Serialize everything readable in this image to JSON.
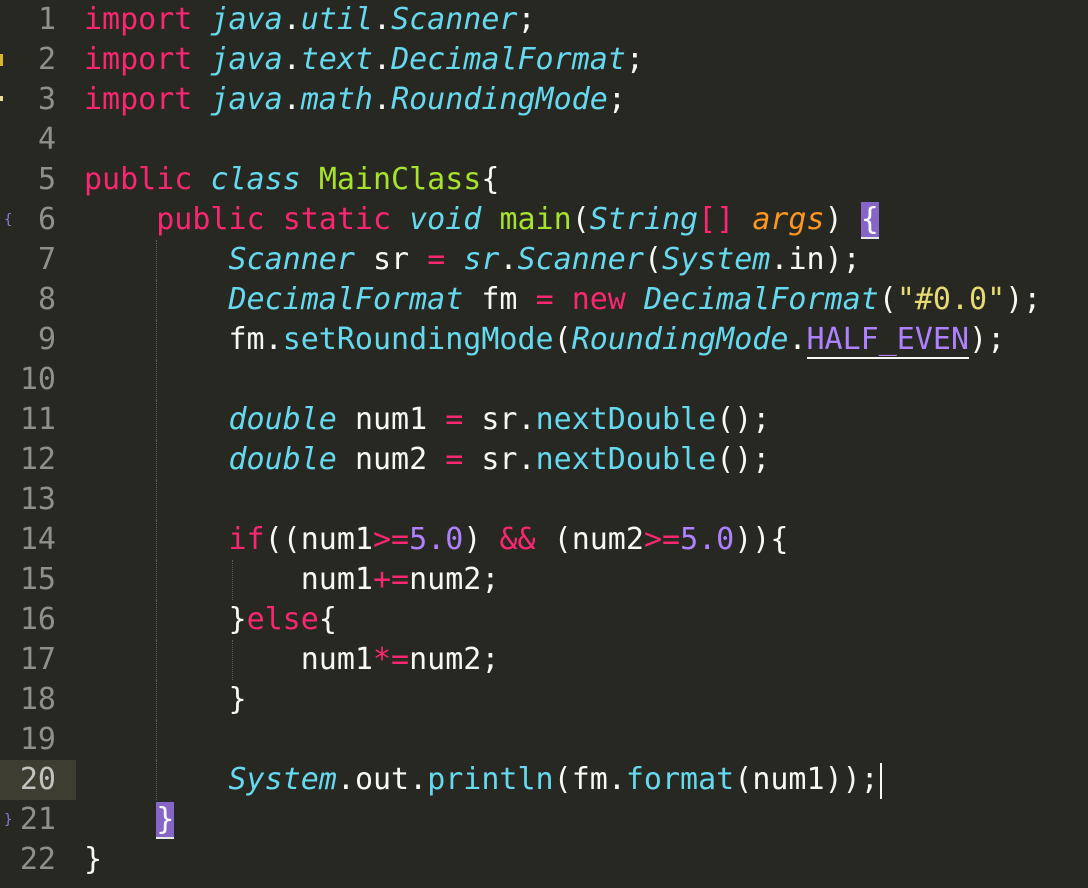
{
  "editor": {
    "theme_colors": {
      "background": "#272822",
      "keyword": "#f92672",
      "type": "#66d9ef",
      "class": "#a6e22e",
      "number": "#ae81ff",
      "string": "#e6db74",
      "parameter": "#fd971f",
      "text": "#f8f8f2"
    },
    "active_line": 20,
    "lines": [
      {
        "n": "1"
      },
      {
        "n": "2"
      },
      {
        "n": "3"
      },
      {
        "n": "4"
      },
      {
        "n": "5"
      },
      {
        "n": "6"
      },
      {
        "n": "7"
      },
      {
        "n": "8"
      },
      {
        "n": "9"
      },
      {
        "n": "10"
      },
      {
        "n": "11"
      },
      {
        "n": "12"
      },
      {
        "n": "13"
      },
      {
        "n": "14"
      },
      {
        "n": "15"
      },
      {
        "n": "16"
      },
      {
        "n": "17"
      },
      {
        "n": "18"
      },
      {
        "n": "19"
      },
      {
        "n": "20"
      },
      {
        "n": "21"
      },
      {
        "n": "22"
      }
    ],
    "tokens": {
      "l1": [
        "import",
        "java",
        ".",
        "util",
        ".",
        "Scanner",
        ";"
      ],
      "l2": [
        "import",
        "java",
        ".",
        "text",
        ".",
        "DecimalFormat",
        ";"
      ],
      "l3": [
        "import",
        "java",
        ".",
        "math",
        ".",
        "RoundingMode",
        ";"
      ],
      "l5": [
        "public",
        "class",
        "MainClass",
        "{"
      ],
      "l6": [
        "public",
        "static",
        "void",
        "main",
        "(",
        "String",
        "[]",
        "args",
        ")",
        "{"
      ],
      "l7": [
        "Scanner",
        "sr",
        "=",
        "sr",
        ".",
        "Scanner",
        "(",
        "System",
        ".",
        "in",
        ");"
      ],
      "l8": [
        "DecimalFormat",
        "fm",
        "=",
        "new",
        "DecimalFormat",
        "(",
        "\"#0.0\"",
        ");"
      ],
      "l9": [
        "fm",
        ".",
        "setRoundingMode",
        "(",
        "RoundingMode",
        ".",
        "HALF_EVEN",
        ");"
      ],
      "l11": [
        "double",
        "num1",
        "=",
        "sr",
        ".",
        "nextDouble",
        "();"
      ],
      "l12": [
        "double",
        "num2",
        "=",
        "sr",
        ".",
        "nextDouble",
        "();"
      ],
      "l14": [
        "if",
        "((",
        "num1",
        ">=",
        "5.0",
        ")",
        "&&",
        "(",
        "num2",
        ">=",
        "5.0",
        ")){"
      ],
      "l15": [
        "num1",
        "+=",
        "num2",
        ";"
      ],
      "l16": [
        "}",
        "else",
        "{"
      ],
      "l17": [
        "num1",
        "*=",
        "num2",
        ";"
      ],
      "l18": [
        "}"
      ],
      "l20": [
        "System",
        ".",
        "out",
        ".",
        "println",
        "(",
        "fm",
        ".",
        "format",
        "(",
        "num1",
        "));"
      ],
      "l21": [
        "}"
      ],
      "l22": [
        "}"
      ]
    },
    "gutter_marks": {
      "fold_open": "{",
      "fold_close": "}"
    }
  }
}
